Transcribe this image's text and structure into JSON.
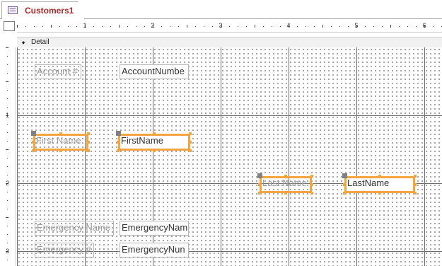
{
  "tab": {
    "title": "Customers1",
    "icon": "form-icon"
  },
  "section": {
    "label": "Detail",
    "icon": "section-arrow-icon"
  },
  "ruler": {
    "h_numbers": [
      "1",
      "2",
      "3",
      "4",
      "5",
      "6"
    ],
    "v_numbers": [
      "1",
      "2",
      "3"
    ]
  },
  "fields": [
    {
      "label": "Account #",
      "textbox": "AccountNumbe",
      "selected": false
    },
    {
      "label": "First Name",
      "textbox": "FirstName",
      "selected": true
    },
    {
      "label": "Last Name",
      "textbox": "LastName",
      "selected": true
    },
    {
      "label": "Emergency Name",
      "textbox": "EmergencyNam",
      "selected": false
    },
    {
      "label": "Emergency #",
      "textbox": "EmergencyNun",
      "selected": false
    }
  ],
  "colors": {
    "selection": "#f4a540",
    "tab_text": "#a52a2a",
    "label_text": "#9a9a9a"
  }
}
